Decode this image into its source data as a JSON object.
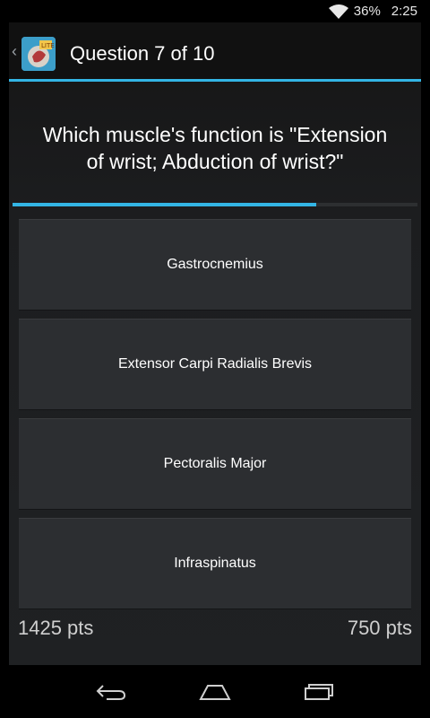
{
  "status_bar": {
    "battery": "36%",
    "time": "2:25",
    "icons": [
      "wifi-icon",
      "battery-icon"
    ]
  },
  "action_bar": {
    "title": "Question 7 of 10",
    "app_icon": "anatomy-app-icon",
    "up_icon": "up-caret-icon"
  },
  "question": {
    "line1": "Which muscle's function is \"Extension",
    "line2": "of wrist; Abduction of wrist?\""
  },
  "progress": {
    "fraction": 0.75,
    "color": "#33b5e5"
  },
  "answers": [
    {
      "label": "Gastrocnemius"
    },
    {
      "label": "Extensor Carpi Radialis Brevis"
    },
    {
      "label": "Pectoralis Major"
    },
    {
      "label": "Infraspinatus"
    }
  ],
  "scores": {
    "left": "1425 pts",
    "right": "750 pts"
  },
  "nav_bar": {
    "buttons": [
      "back-icon",
      "home-icon",
      "recents-icon"
    ]
  },
  "colors": {
    "accent": "#33b5e5",
    "answer_bg": "#2c2e31"
  }
}
